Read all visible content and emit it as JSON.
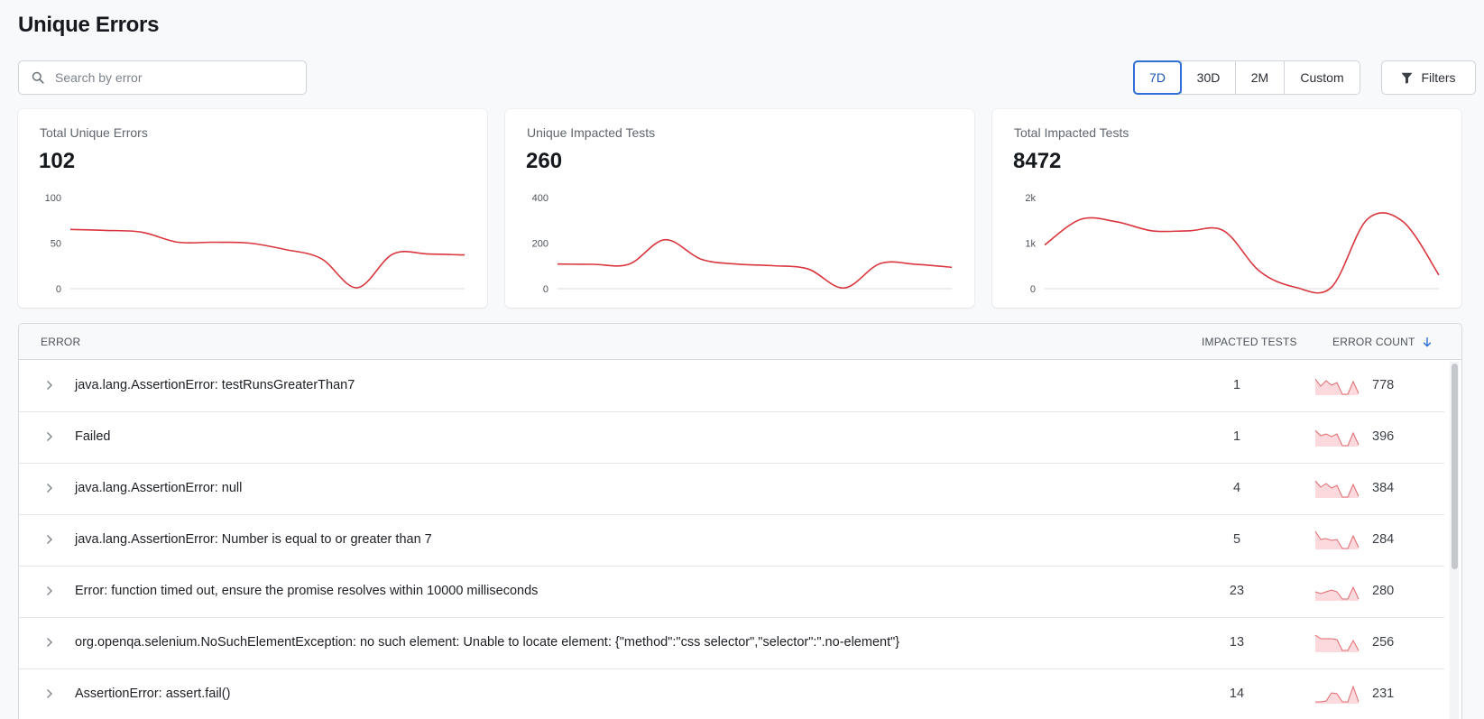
{
  "page": {
    "title": "Unique Errors"
  },
  "search": {
    "placeholder": "Search by error",
    "value": ""
  },
  "date_ranges": [
    {
      "label": "7D",
      "active": true
    },
    {
      "label": "30D",
      "active": false
    },
    {
      "label": "2M",
      "active": false
    },
    {
      "label": "Custom",
      "active": false
    }
  ],
  "filters": {
    "label": "Filters"
  },
  "colors": {
    "accent": "#2f6fd6",
    "line": "#d9363e",
    "area": "#fbd9dc"
  },
  "cards": [
    {
      "label": "Total Unique Errors",
      "value": "102",
      "ticks": [
        {
          "label": "100",
          "v": 100
        },
        {
          "label": "50",
          "v": 50
        },
        {
          "label": "0",
          "v": 0
        }
      ],
      "ymax": 100,
      "series": [
        65,
        64,
        62,
        51,
        51,
        50,
        43,
        33,
        1,
        38,
        38,
        37
      ]
    },
    {
      "label": "Unique Impacted Tests",
      "value": "260",
      "ticks": [
        {
          "label": "400",
          "v": 400
        },
        {
          "label": "200",
          "v": 200
        },
        {
          "label": "0",
          "v": 0
        }
      ],
      "ymax": 400,
      "series": [
        108,
        107,
        108,
        215,
        130,
        108,
        101,
        86,
        3,
        110,
        107,
        94
      ]
    },
    {
      "label": "Total Impacted Tests",
      "value": "8472",
      "ticks": [
        {
          "label": "2k",
          "v": 2000
        },
        {
          "label": "1k",
          "v": 1000
        },
        {
          "label": "0",
          "v": 0
        }
      ],
      "ymax": 2000,
      "series": [
        960,
        1520,
        1470,
        1270,
        1270,
        1270,
        380,
        30,
        30,
        1520,
        1470,
        300
      ]
    }
  ],
  "table": {
    "headers": {
      "error": "ERROR",
      "impacted": "IMPACTED TESTS",
      "count": "ERROR COUNT"
    },
    "rows": [
      {
        "error": "java.lang.AssertionError: testRunsGreaterThan7",
        "impacted": "1",
        "count": "778",
        "trend": [
          0.9,
          0.5,
          0.8,
          0.55,
          0.7,
          0.05,
          0.05,
          0.75,
          0.1
        ]
      },
      {
        "error": "Failed",
        "impacted": "1",
        "count": "396",
        "trend": [
          0.9,
          0.6,
          0.7,
          0.55,
          0.7,
          0.05,
          0.05,
          0.75,
          0.1
        ]
      },
      {
        "error": "java.lang.AssertionError: null",
        "impacted": "4",
        "count": "384",
        "trend": [
          0.95,
          0.6,
          0.8,
          0.55,
          0.7,
          0.05,
          0.05,
          0.75,
          0.1
        ]
      },
      {
        "error": "java.lang.AssertionError: Number is equal to or greater than 7",
        "impacted": "5",
        "count": "284",
        "trend": [
          1.0,
          0.55,
          0.6,
          0.5,
          0.55,
          0.05,
          0.05,
          0.75,
          0.1
        ]
      },
      {
        "error": "Error: function timed out, ensure the promise resolves within 10000 milliseconds",
        "impacted": "23",
        "count": "280",
        "trend": [
          0.5,
          0.4,
          0.5,
          0.6,
          0.5,
          0.1,
          0.1,
          0.75,
          0.1
        ]
      },
      {
        "error": "org.openqa.selenium.NoSuchElementException: no such element: Unable to locate element: {\"method\":\"css selector\",\"selector\":\".no-element\"}",
        "impacted": "13",
        "count": "256",
        "trend": [
          0.95,
          0.75,
          0.75,
          0.75,
          0.7,
          0.1,
          0.1,
          0.65,
          0.1
        ]
      },
      {
        "error": "AssertionError: assert.fail()",
        "impacted": "14",
        "count": "231",
        "trend": [
          0.1,
          0.1,
          0.15,
          0.6,
          0.55,
          0.1,
          0.1,
          0.95,
          0.1
        ]
      }
    ]
  }
}
